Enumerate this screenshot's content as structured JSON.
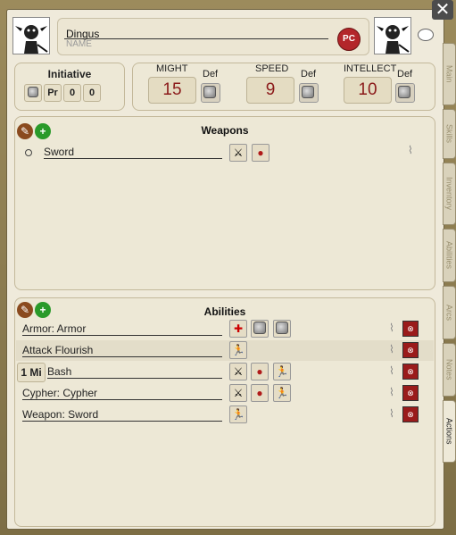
{
  "window": {
    "close_label": "✕"
  },
  "header": {
    "character_name": "Dingus",
    "name_label": "NAME",
    "type_badge": "PC"
  },
  "initiative": {
    "title": "Initiative",
    "pr_label": "Pr",
    "value_a": "0",
    "value_b": "0"
  },
  "stats": {
    "might": {
      "label": "MIGHT",
      "value": "15",
      "def_label": "Def"
    },
    "speed": {
      "label": "SPEED",
      "value": "9",
      "def_label": "Def"
    },
    "intellect": {
      "label": "INTELLECT",
      "value": "10",
      "def_label": "Def"
    }
  },
  "weapons": {
    "title": "Weapons",
    "items": [
      {
        "name": "Sword"
      }
    ]
  },
  "abilities": {
    "title": "Abilities",
    "items": [
      {
        "name": "Armor: Armor"
      },
      {
        "name": "Attack Flourish"
      },
      {
        "prefix": "1 Mi",
        "name": "Bash"
      },
      {
        "name": "Cypher: Cypher"
      },
      {
        "name": "Weapon: Sword"
      }
    ]
  },
  "tabs": [
    {
      "label": "Main"
    },
    {
      "label": "Skills"
    },
    {
      "label": "Inventory"
    },
    {
      "label": "Abilities"
    },
    {
      "label": "Arcs"
    },
    {
      "label": "Notes"
    },
    {
      "label": "Actions"
    }
  ]
}
